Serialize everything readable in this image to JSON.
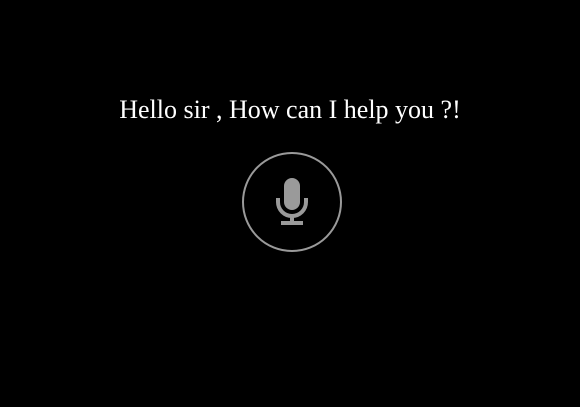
{
  "assistant": {
    "greeting": "Hello sir , How can I help you ?!"
  },
  "mic_button": {
    "icon": "microphone-icon"
  },
  "colors": {
    "background": "#000000",
    "text": "#ffffff",
    "mic": "#9a9a9a"
  }
}
